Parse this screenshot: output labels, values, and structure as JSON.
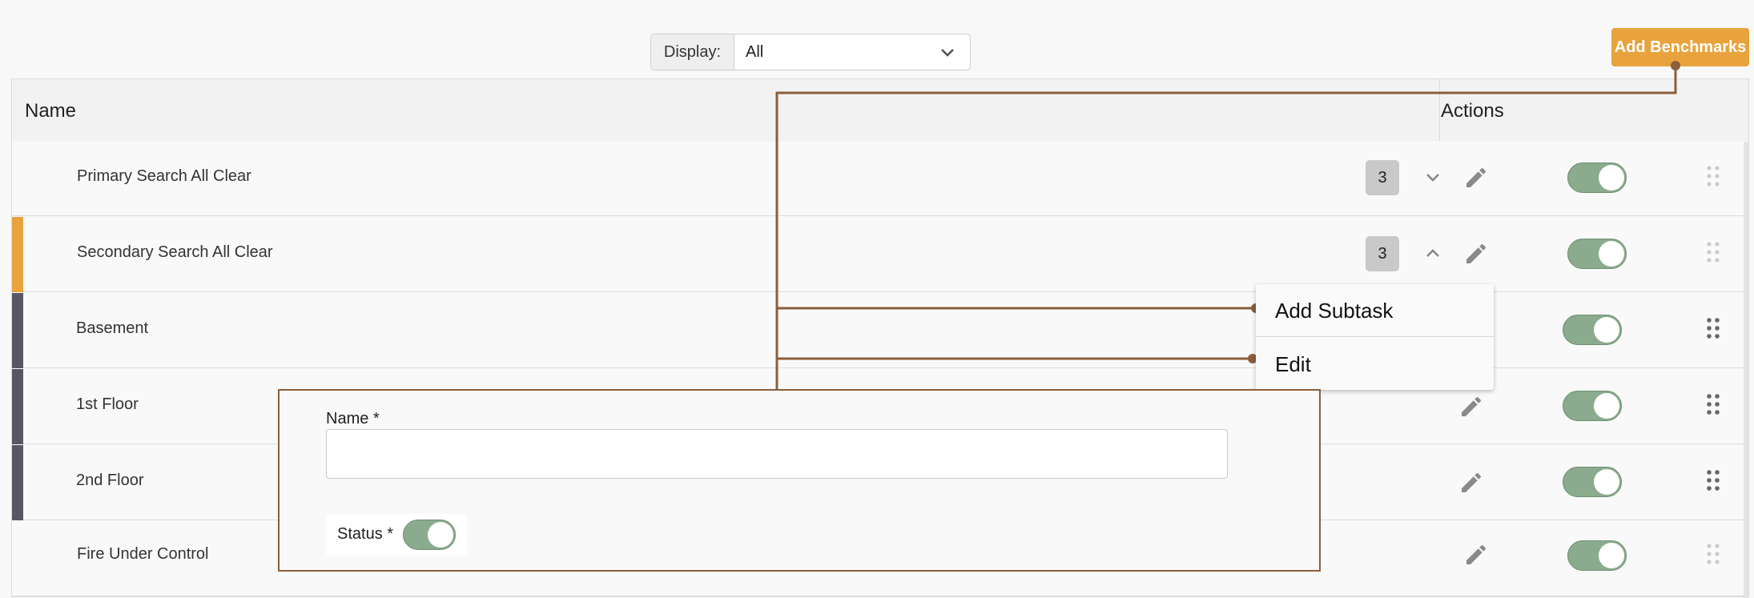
{
  "filter": {
    "label": "Display:",
    "value": "All"
  },
  "header": {
    "add_benchmarks_label": "Add Benchmarks"
  },
  "table": {
    "columns": {
      "name": "Name",
      "actions": "Actions"
    },
    "rows": [
      {
        "name": "Primary Search All Clear",
        "count": "3",
        "expanded": false,
        "bar_color": "",
        "enabled": true
      },
      {
        "name": "Secondary Search All Clear",
        "count": "3",
        "expanded": true,
        "bar_color": "#e8a33d",
        "enabled": true
      },
      {
        "name": "Basement",
        "bar_color": "#575764",
        "enabled": true
      },
      {
        "name": "1st Floor",
        "bar_color": "#575764",
        "enabled": true
      },
      {
        "name": "2nd Floor",
        "bar_color": "#575764",
        "enabled": true
      },
      {
        "name": "Fire Under Control",
        "bar_color": "",
        "enabled": true
      }
    ]
  },
  "menu": {
    "items": [
      "Add Subtask",
      "Edit"
    ]
  },
  "form": {
    "name_label": "Name *",
    "name_value": "",
    "status_label": "Status *",
    "status_enabled": true
  },
  "colors": {
    "accent": "#e8a33d",
    "toggle_on": "#8aab8d",
    "connector": "#8b5e3c",
    "subtask_bar": "#575764"
  }
}
